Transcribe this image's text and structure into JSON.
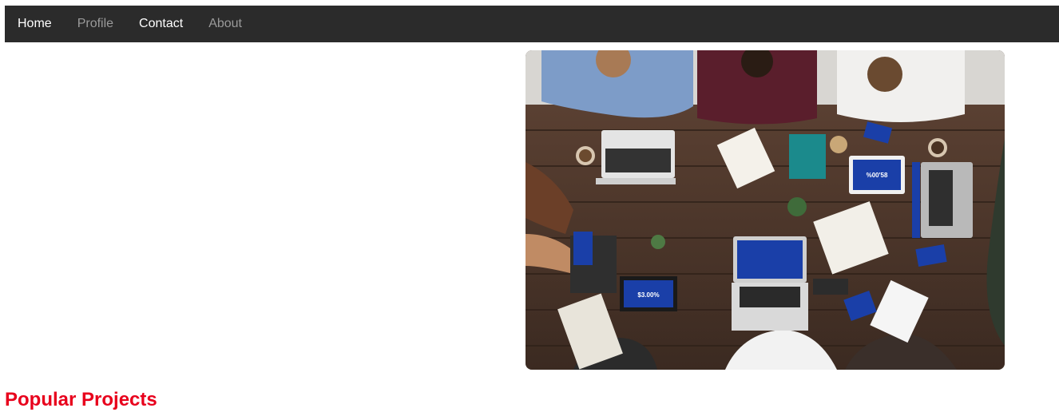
{
  "nav": {
    "items": [
      {
        "label": "Home",
        "state": "active"
      },
      {
        "label": "Profile",
        "state": "muted"
      },
      {
        "label": "Contact",
        "state": "active"
      },
      {
        "label": "About",
        "state": "muted"
      }
    ]
  },
  "hero": {
    "image": "team-meeting-top-view-photo",
    "screen_texts": [
      "%00'58",
      "$3.00%"
    ]
  },
  "section": {
    "title": "Popular Projects"
  },
  "colors": {
    "navbar_bg": "#2b2b2b",
    "nav_active": "#ffffff",
    "nav_muted": "#9a9a9a",
    "section_title": "#e8001c",
    "table_wood": "#4a3428"
  }
}
